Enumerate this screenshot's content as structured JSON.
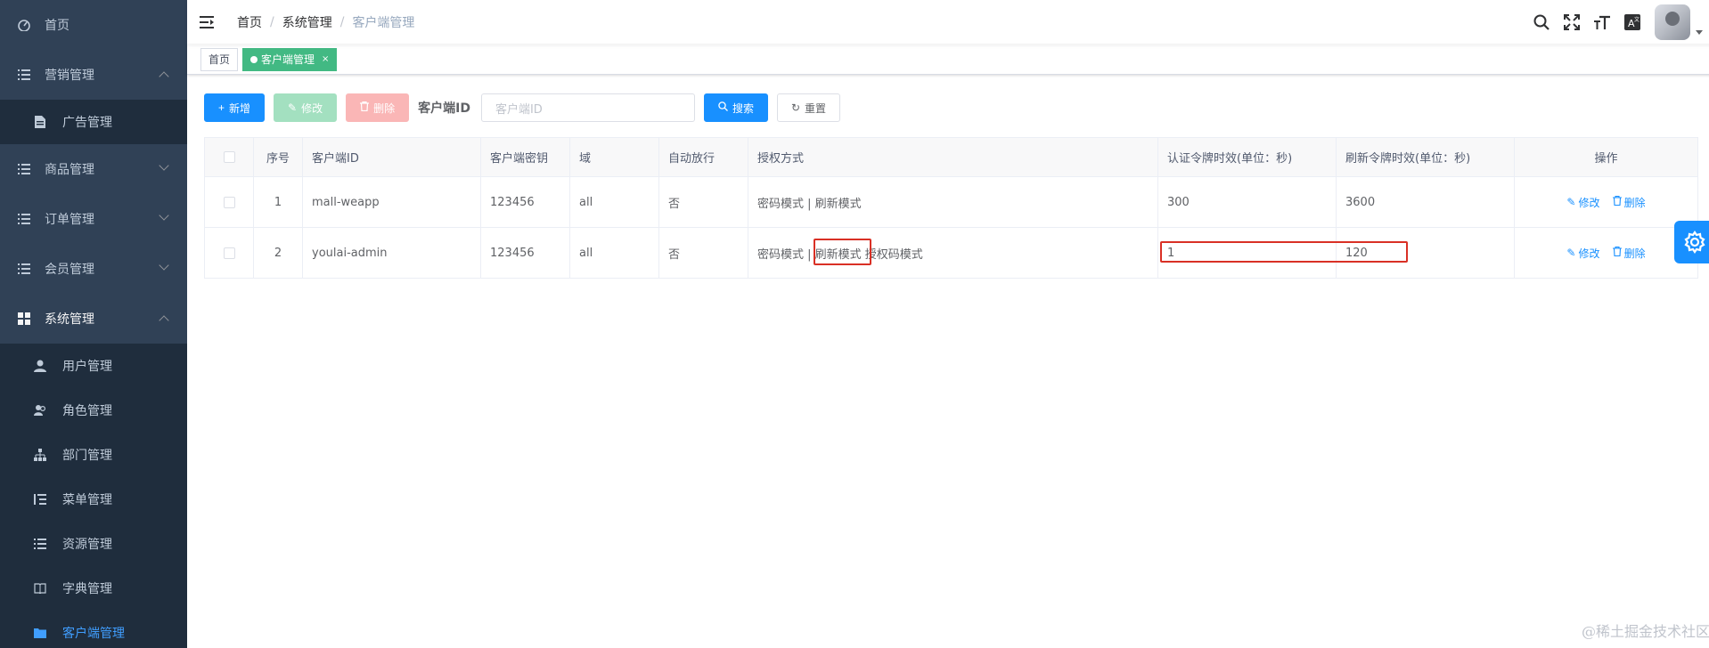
{
  "sidebar": {
    "home": "首页",
    "marketing": "营销管理",
    "ads": "广告管理",
    "goods": "商品管理",
    "orders": "订单管理",
    "members": "会员管理",
    "system": "系统管理",
    "users": "用户管理",
    "roles": "角色管理",
    "depts": "部门管理",
    "menus": "菜单管理",
    "resources": "资源管理",
    "dict": "字典管理",
    "clients": "客户端管理"
  },
  "breadcrumb": [
    "首页",
    "系统管理",
    "客户端管理"
  ],
  "tags": {
    "home": "首页",
    "active": "客户端管理",
    "close": "×"
  },
  "toolbar": {
    "add": "新增",
    "edit": "修改",
    "delete": "删除",
    "client_id_label": "客户端ID",
    "client_id_placeholder": "客户端ID",
    "search": "搜索",
    "reset": "重置"
  },
  "table": {
    "headers": [
      "序号",
      "客户端ID",
      "客户端密钥",
      "域",
      "自动放行",
      "授权方式",
      "认证令牌时效(单位：秒)",
      "刷新令牌时效(单位：秒)",
      "操作"
    ],
    "rows": [
      {
        "index": "1",
        "client_id": "mall-weapp",
        "secret": "123456",
        "scope": "all",
        "auto": "否",
        "grant_pre": "密码模式 | 刷新模式",
        "grant_mid": "",
        "grant_post": "",
        "access": "300",
        "refresh": "3600"
      },
      {
        "index": "2",
        "client_id": "youlai-admin",
        "secret": "123456",
        "scope": "all",
        "auto": "否",
        "grant_pre": "密码模式 | ",
        "grant_mid": "刷新模式",
        "grant_post": " 授权码模式",
        "access": "1",
        "refresh": "120"
      }
    ],
    "op_edit": "修改",
    "op_delete": "删除"
  },
  "watermark": "@稀土掘金技术社区",
  "colors": {
    "sidebar": "#304156",
    "primary": "#1890ff",
    "tag_active": "#42b983",
    "highlight": "#d93025"
  }
}
